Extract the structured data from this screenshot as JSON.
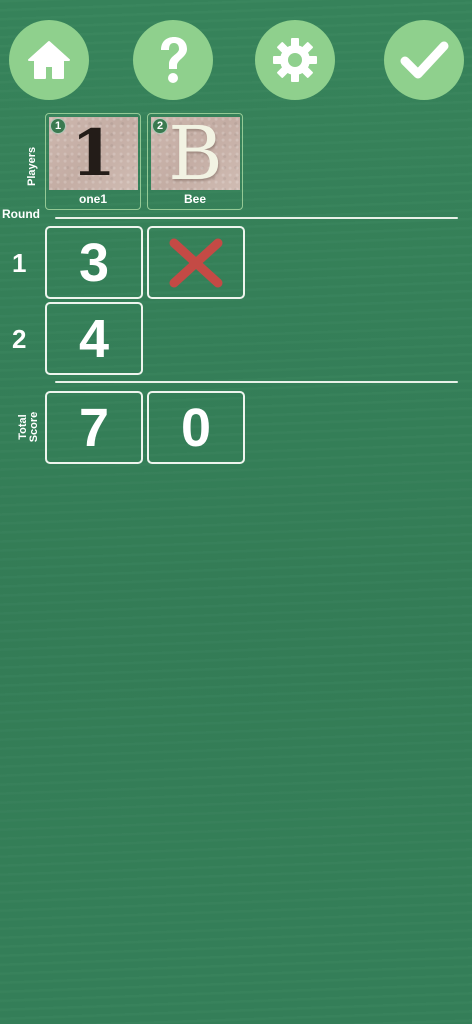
{
  "toolbar": {
    "home_icon": "home-icon",
    "help_icon": "question-mark-icon",
    "settings_icon": "gear-icon",
    "confirm_icon": "checkmark-icon"
  },
  "players": {
    "label": "Players",
    "items": [
      {
        "number": "1",
        "name": "one1",
        "avatar_glyph": "1"
      },
      {
        "number": "2",
        "name": "Bee",
        "avatar_glyph": "B"
      }
    ]
  },
  "rounds": {
    "label": "Round",
    "rows": [
      {
        "round": "1",
        "scores": [
          "3",
          "x-mark"
        ]
      },
      {
        "round": "2",
        "scores": [
          "4"
        ]
      }
    ]
  },
  "total": {
    "label_line1": "Total",
    "label_line2": "Score",
    "scores": [
      "7",
      "0"
    ]
  },
  "colors": {
    "background": "#37805a",
    "button": "#8fd08d",
    "x_mark": "#c44a45",
    "text": "#ffffff"
  }
}
